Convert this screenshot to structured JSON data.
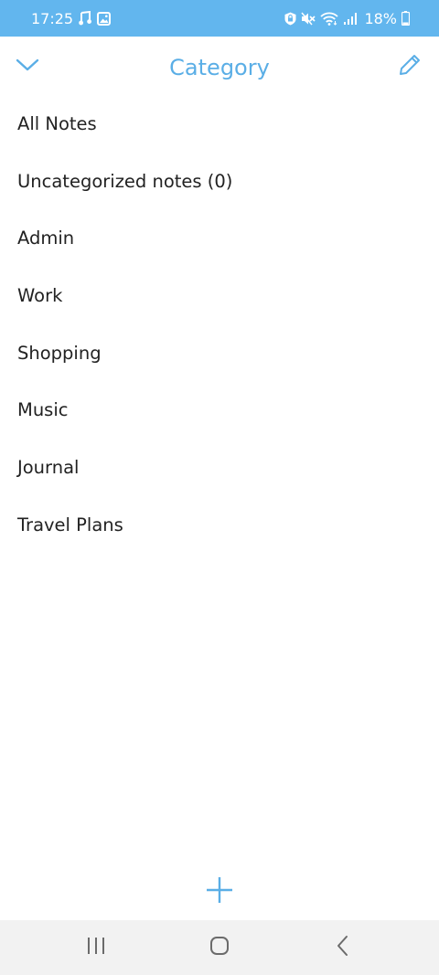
{
  "status_bar": {
    "time": "17:25",
    "battery": "18%",
    "icons": [
      "music-note-icon",
      "image-icon",
      "lock-badge-icon",
      "mute-icon",
      "wifi-icon",
      "signal-icon",
      "battery-icon"
    ]
  },
  "header": {
    "title": "Category",
    "left_icon": "chevron-down-icon",
    "right_icon": "pencil-icon"
  },
  "categories": [
    {
      "label": "All Notes"
    },
    {
      "label": "Uncategorized notes (0)"
    },
    {
      "label": "Admin"
    },
    {
      "label": "Work"
    },
    {
      "label": "Shopping"
    },
    {
      "label": "Music"
    },
    {
      "label": "Journal"
    },
    {
      "label": "Travel Plans"
    }
  ],
  "actions": {
    "add_icon": "plus-icon"
  },
  "nav_bar": {
    "icons": [
      "recent-apps-icon",
      "home-icon",
      "back-icon"
    ]
  },
  "colors": {
    "status_bar": "#62b6ee",
    "accent": "#5aaee6",
    "text": "#222222",
    "nav_bar": "#f2f2f2"
  }
}
